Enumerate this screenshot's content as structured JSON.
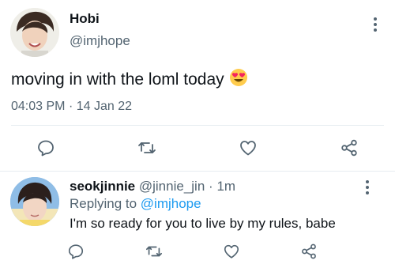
{
  "tweet": {
    "author_name": "Hobi",
    "author_handle": "@imjhope",
    "text": "moving in with the loml today",
    "emoji": "heart-eyes-emoji",
    "time": "04:03 PM",
    "separator": "·",
    "date": "14 Jan 22"
  },
  "reply": {
    "author_name": "seokjinnie",
    "author_handle": "@jinnie_jin",
    "separator": "·",
    "age": "1m",
    "replying_prefix": "Replying to",
    "replying_handle": "@imjhope",
    "text": "I'm so ready for you to live by my rules, babe"
  },
  "actions": [
    "reply-icon",
    "retweet-icon",
    "like-icon",
    "share-icon"
  ],
  "colors": {
    "text": "#0f1419",
    "secondary": "#536471",
    "link": "#1d9bf0",
    "divider": "#e6ecf0",
    "emoji": "#ffcc4d",
    "emoji_heart": "#f4245e"
  }
}
